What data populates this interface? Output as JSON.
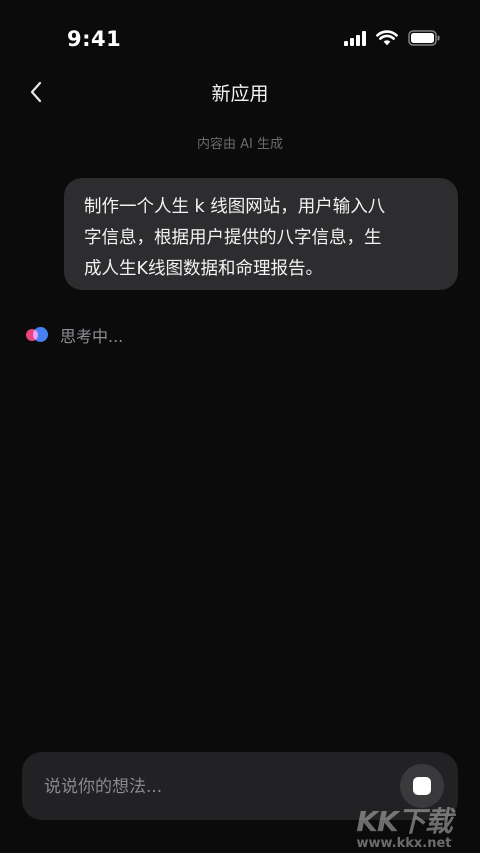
{
  "status_bar": {
    "time": "9:41",
    "icons": [
      "cellular-signal-icon",
      "wifi-icon",
      "battery-icon"
    ]
  },
  "nav": {
    "back_icon": "chevron-left-icon",
    "title": "新应用"
  },
  "chat": {
    "disclaimer": "内容由 AI 生成",
    "user_message_lines": [
      "制作一个人生 k 线图网站，用户输入八",
      "字信息，根据用户提供的八字信息，生",
      "成人生K线图数据和命理报告。"
    ],
    "thinking": {
      "icon": "ai-thinking-icon",
      "text": "思考中..."
    }
  },
  "composer": {
    "placeholder": "说说你的想法...",
    "stop_icon": "stop-icon"
  },
  "watermark": {
    "logo": "KK下载",
    "url": "www.kkx.net"
  },
  "colors": {
    "background": "#0b0b0c",
    "bubble": "#2d2d2f",
    "composer": "#222224",
    "thinking_pink": "#e8457f",
    "thinking_blue": "#3d7bf5"
  }
}
